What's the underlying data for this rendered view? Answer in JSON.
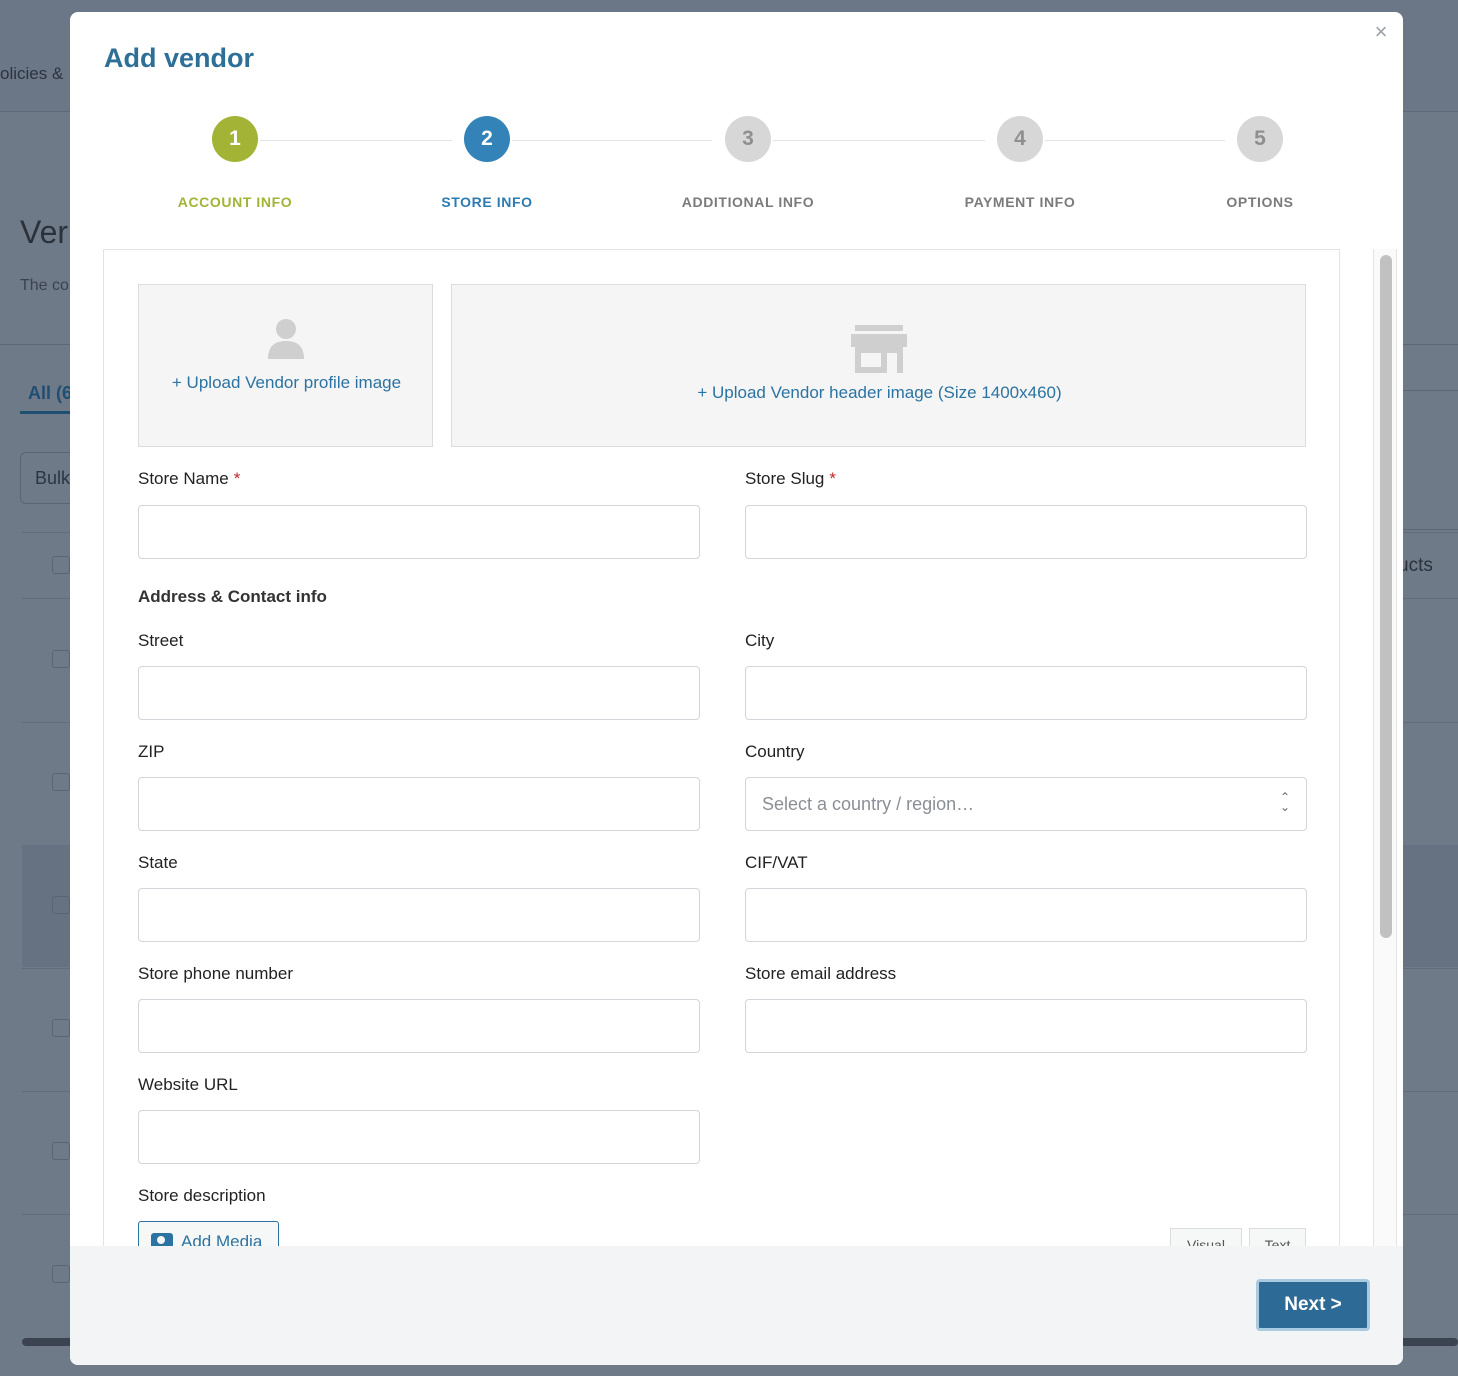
{
  "background": {
    "nav_partial": "olicies & ",
    "heading_partial": "Ver",
    "desc_partial": "The co",
    "tab_all": "All (6",
    "bulk_partial": "Bulk",
    "column_partial": "ucts"
  },
  "modal": {
    "title": "Add vendor",
    "close_label": "×",
    "steps": [
      {
        "number": "1",
        "label": "ACCOUNT INFO",
        "state": "done"
      },
      {
        "number": "2",
        "label": "STORE INFO",
        "state": "active"
      },
      {
        "number": "3",
        "label": "ADDITIONAL INFO",
        "state": "todo"
      },
      {
        "number": "4",
        "label": "PAYMENT INFO",
        "state": "todo"
      },
      {
        "number": "5",
        "label": "OPTIONS",
        "state": "todo"
      }
    ],
    "colors": {
      "done": "#a3b336",
      "active": "#3382b8",
      "todo": "#d7d7d7",
      "title": "#2d6f96",
      "link": "#2b73a2"
    }
  },
  "form": {
    "upload_profile": "+ Upload Vendor profile image",
    "upload_header": "+ Upload Vendor header image (Size 1400x460)",
    "store_name_label": "Store Name",
    "store_slug_label": "Store Slug",
    "required_mark": "*",
    "address_section": "Address & Contact info",
    "street_label": "Street",
    "city_label": "City",
    "zip_label": "ZIP",
    "country_label": "Country",
    "country_placeholder": "Select a country / region…",
    "state_label": "State",
    "cifvat_label": "CIF/VAT",
    "phone_label": "Store phone number",
    "email_label": "Store email address",
    "website_label": "Website URL",
    "description_label": "Store description",
    "add_media": "Add Media",
    "editor_tabs": [
      "Visual",
      "Text"
    ]
  },
  "footer": {
    "next_label": "Next >"
  }
}
